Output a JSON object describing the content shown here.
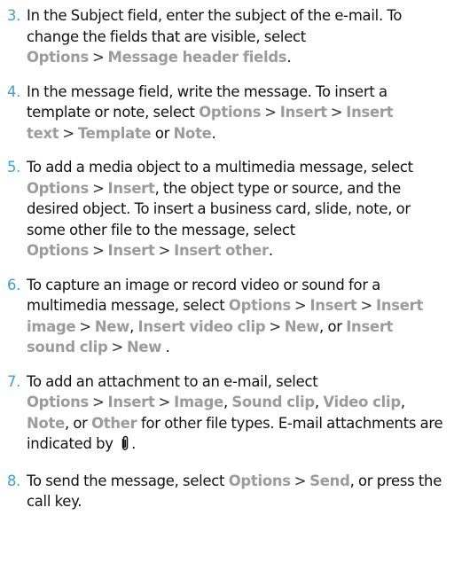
{
  "steps": [
    {
      "number": "3.",
      "parts": [
        {
          "t": "text",
          "v": "In the Subject field, enter the subject of the e-mail. To change the fields that are visible, select "
        },
        {
          "t": "kw",
          "v": "Options"
        },
        {
          "t": "sep",
          "v": ">"
        },
        {
          "t": "kw",
          "v": "Message header fields"
        },
        {
          "t": "text",
          "v": "."
        }
      ]
    },
    {
      "number": "4.",
      "parts": [
        {
          "t": "text",
          "v": "In the message field, write the message. To insert a template or note, select "
        },
        {
          "t": "kw",
          "v": "Options"
        },
        {
          "t": "sep",
          "v": ">"
        },
        {
          "t": "kw",
          "v": "Insert"
        },
        {
          "t": "sep",
          "v": ">"
        },
        {
          "t": "kw",
          "v": "Insert text"
        },
        {
          "t": "sep",
          "v": ">"
        },
        {
          "t": "kw",
          "v": "Template"
        },
        {
          "t": "text",
          "v": " or "
        },
        {
          "t": "kw",
          "v": "Note"
        },
        {
          "t": "text",
          "v": "."
        }
      ]
    },
    {
      "number": "5.",
      "parts": [
        {
          "t": "text",
          "v": "To add a media object to a multimedia message, select "
        },
        {
          "t": "kw",
          "v": "Options"
        },
        {
          "t": "sep",
          "v": ">"
        },
        {
          "t": "kw",
          "v": "Insert"
        },
        {
          "t": "text",
          "v": ", the object type or source, and the desired object. To insert a business card, slide, note, or some other file to the message, select "
        },
        {
          "t": "kw",
          "v": "Options"
        },
        {
          "t": "sep",
          "v": ">"
        },
        {
          "t": "kw",
          "v": "Insert"
        },
        {
          "t": "sep",
          "v": ">"
        },
        {
          "t": "kw",
          "v": "Insert other"
        },
        {
          "t": "text",
          "v": "."
        }
      ]
    },
    {
      "number": "6.",
      "parts": [
        {
          "t": "text",
          "v": "To capture an image or record video or sound for a multimedia message, select "
        },
        {
          "t": "kw",
          "v": "Options"
        },
        {
          "t": "sep",
          "v": ">"
        },
        {
          "t": "kw",
          "v": "Insert"
        },
        {
          "t": "sep",
          "v": ">"
        },
        {
          "t": "kw",
          "v": "Insert image"
        },
        {
          "t": "sep",
          "v": ">"
        },
        {
          "t": "kw",
          "v": "New"
        },
        {
          "t": "text",
          "v": ", "
        },
        {
          "t": "kw",
          "v": "Insert video clip"
        },
        {
          "t": "sep",
          "v": ">"
        },
        {
          "t": "kw",
          "v": "New"
        },
        {
          "t": "text",
          "v": ", or "
        },
        {
          "t": "kw",
          "v": "Insert sound clip"
        },
        {
          "t": "sep",
          "v": ">"
        },
        {
          "t": "kw",
          "v": "New"
        },
        {
          "t": "text",
          "v": " ."
        }
      ]
    },
    {
      "number": "7.",
      "parts": [
        {
          "t": "text",
          "v": "To add an attachment to an e-mail, select "
        },
        {
          "t": "kw",
          "v": "Options"
        },
        {
          "t": "sep",
          "v": ">"
        },
        {
          "t": "kw",
          "v": "Insert"
        },
        {
          "t": "sep",
          "v": ">"
        },
        {
          "t": "kw",
          "v": "Image"
        },
        {
          "t": "text",
          "v": ", "
        },
        {
          "t": "kw",
          "v": "Sound clip"
        },
        {
          "t": "text",
          "v": ", "
        },
        {
          "t": "kw",
          "v": "Video clip"
        },
        {
          "t": "text",
          "v": ", "
        },
        {
          "t": "kw",
          "v": "Note"
        },
        {
          "t": "text",
          "v": ", or "
        },
        {
          "t": "kw",
          "v": "Other"
        },
        {
          "t": "text",
          "v": " for other file types. E-mail attachments are indicated by "
        },
        {
          "t": "icon",
          "v": "attachment-clip-icon"
        },
        {
          "t": "text",
          "v": "."
        }
      ]
    },
    {
      "number": "8.",
      "parts": [
        {
          "t": "text",
          "v": "To send the message, select "
        },
        {
          "t": "kw",
          "v": "Options"
        },
        {
          "t": "sep",
          "v": ">"
        },
        {
          "t": "kw",
          "v": "Send"
        },
        {
          "t": "text",
          "v": ", or press the call key."
        }
      ]
    }
  ],
  "colors": {
    "number": "#3da0d0",
    "keyword": "#9b9b9b",
    "text": "#111111"
  }
}
